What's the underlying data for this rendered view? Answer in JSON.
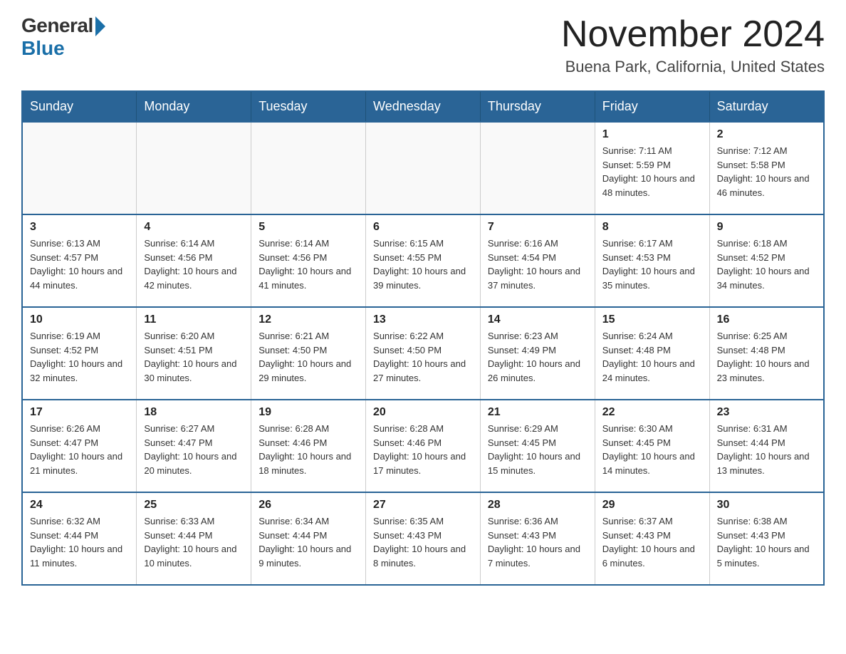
{
  "logo": {
    "general": "General",
    "blue": "Blue"
  },
  "header": {
    "month": "November 2024",
    "location": "Buena Park, California, United States"
  },
  "days_of_week": [
    "Sunday",
    "Monday",
    "Tuesday",
    "Wednesday",
    "Thursday",
    "Friday",
    "Saturday"
  ],
  "weeks": [
    [
      {
        "day": "",
        "info": ""
      },
      {
        "day": "",
        "info": ""
      },
      {
        "day": "",
        "info": ""
      },
      {
        "day": "",
        "info": ""
      },
      {
        "day": "",
        "info": ""
      },
      {
        "day": "1",
        "info": "Sunrise: 7:11 AM\nSunset: 5:59 PM\nDaylight: 10 hours and 48 minutes."
      },
      {
        "day": "2",
        "info": "Sunrise: 7:12 AM\nSunset: 5:58 PM\nDaylight: 10 hours and 46 minutes."
      }
    ],
    [
      {
        "day": "3",
        "info": "Sunrise: 6:13 AM\nSunset: 4:57 PM\nDaylight: 10 hours and 44 minutes."
      },
      {
        "day": "4",
        "info": "Sunrise: 6:14 AM\nSunset: 4:56 PM\nDaylight: 10 hours and 42 minutes."
      },
      {
        "day": "5",
        "info": "Sunrise: 6:14 AM\nSunset: 4:56 PM\nDaylight: 10 hours and 41 minutes."
      },
      {
        "day": "6",
        "info": "Sunrise: 6:15 AM\nSunset: 4:55 PM\nDaylight: 10 hours and 39 minutes."
      },
      {
        "day": "7",
        "info": "Sunrise: 6:16 AM\nSunset: 4:54 PM\nDaylight: 10 hours and 37 minutes."
      },
      {
        "day": "8",
        "info": "Sunrise: 6:17 AM\nSunset: 4:53 PM\nDaylight: 10 hours and 35 minutes."
      },
      {
        "day": "9",
        "info": "Sunrise: 6:18 AM\nSunset: 4:52 PM\nDaylight: 10 hours and 34 minutes."
      }
    ],
    [
      {
        "day": "10",
        "info": "Sunrise: 6:19 AM\nSunset: 4:52 PM\nDaylight: 10 hours and 32 minutes."
      },
      {
        "day": "11",
        "info": "Sunrise: 6:20 AM\nSunset: 4:51 PM\nDaylight: 10 hours and 30 minutes."
      },
      {
        "day": "12",
        "info": "Sunrise: 6:21 AM\nSunset: 4:50 PM\nDaylight: 10 hours and 29 minutes."
      },
      {
        "day": "13",
        "info": "Sunrise: 6:22 AM\nSunset: 4:50 PM\nDaylight: 10 hours and 27 minutes."
      },
      {
        "day": "14",
        "info": "Sunrise: 6:23 AM\nSunset: 4:49 PM\nDaylight: 10 hours and 26 minutes."
      },
      {
        "day": "15",
        "info": "Sunrise: 6:24 AM\nSunset: 4:48 PM\nDaylight: 10 hours and 24 minutes."
      },
      {
        "day": "16",
        "info": "Sunrise: 6:25 AM\nSunset: 4:48 PM\nDaylight: 10 hours and 23 minutes."
      }
    ],
    [
      {
        "day": "17",
        "info": "Sunrise: 6:26 AM\nSunset: 4:47 PM\nDaylight: 10 hours and 21 minutes."
      },
      {
        "day": "18",
        "info": "Sunrise: 6:27 AM\nSunset: 4:47 PM\nDaylight: 10 hours and 20 minutes."
      },
      {
        "day": "19",
        "info": "Sunrise: 6:28 AM\nSunset: 4:46 PM\nDaylight: 10 hours and 18 minutes."
      },
      {
        "day": "20",
        "info": "Sunrise: 6:28 AM\nSunset: 4:46 PM\nDaylight: 10 hours and 17 minutes."
      },
      {
        "day": "21",
        "info": "Sunrise: 6:29 AM\nSunset: 4:45 PM\nDaylight: 10 hours and 15 minutes."
      },
      {
        "day": "22",
        "info": "Sunrise: 6:30 AM\nSunset: 4:45 PM\nDaylight: 10 hours and 14 minutes."
      },
      {
        "day": "23",
        "info": "Sunrise: 6:31 AM\nSunset: 4:44 PM\nDaylight: 10 hours and 13 minutes."
      }
    ],
    [
      {
        "day": "24",
        "info": "Sunrise: 6:32 AM\nSunset: 4:44 PM\nDaylight: 10 hours and 11 minutes."
      },
      {
        "day": "25",
        "info": "Sunrise: 6:33 AM\nSunset: 4:44 PM\nDaylight: 10 hours and 10 minutes."
      },
      {
        "day": "26",
        "info": "Sunrise: 6:34 AM\nSunset: 4:44 PM\nDaylight: 10 hours and 9 minutes."
      },
      {
        "day": "27",
        "info": "Sunrise: 6:35 AM\nSunset: 4:43 PM\nDaylight: 10 hours and 8 minutes."
      },
      {
        "day": "28",
        "info": "Sunrise: 6:36 AM\nSunset: 4:43 PM\nDaylight: 10 hours and 7 minutes."
      },
      {
        "day": "29",
        "info": "Sunrise: 6:37 AM\nSunset: 4:43 PM\nDaylight: 10 hours and 6 minutes."
      },
      {
        "day": "30",
        "info": "Sunrise: 6:38 AM\nSunset: 4:43 PM\nDaylight: 10 hours and 5 minutes."
      }
    ]
  ]
}
